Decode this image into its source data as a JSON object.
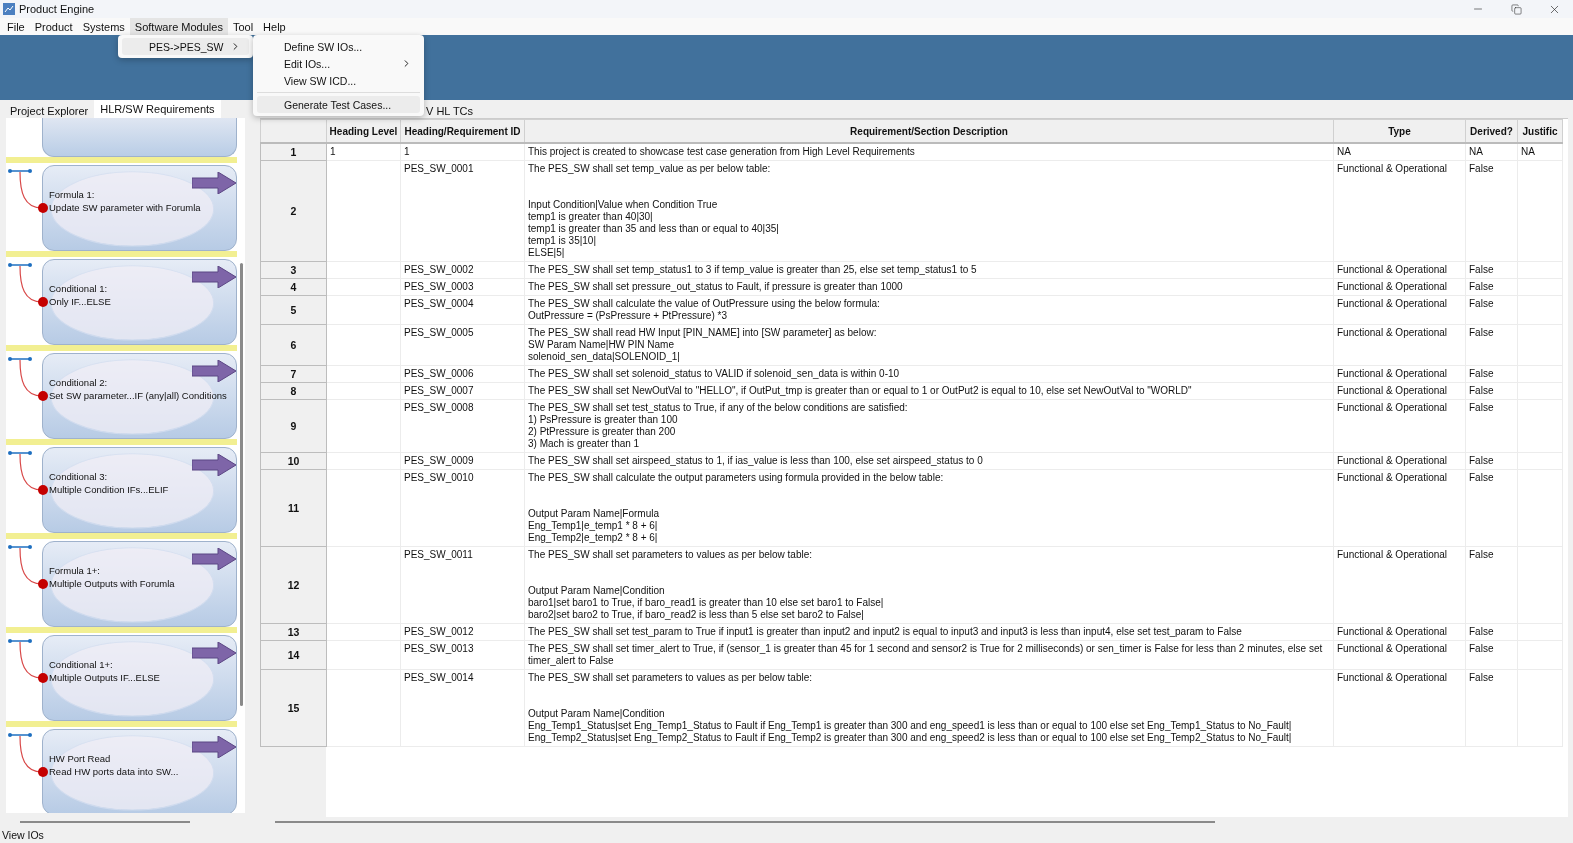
{
  "window": {
    "title": "Product Engine"
  },
  "menu_bar": [
    {
      "label": "File",
      "selected": false
    },
    {
      "label": "Product",
      "selected": false
    },
    {
      "label": "Systems",
      "selected": false
    },
    {
      "label": "Software Modules",
      "selected": true
    },
    {
      "label": "Tool",
      "selected": false
    },
    {
      "label": "Help",
      "selected": false
    }
  ],
  "menu": {
    "items": [
      {
        "label": "PES->PES_SW",
        "selected": true,
        "kind": "submenu"
      }
    ]
  },
  "submenu": {
    "items": [
      {
        "kind": "item",
        "label": "Define SW IOs...",
        "selected": false
      },
      {
        "kind": "submenu",
        "label": "Edit IOs...",
        "selected": false
      },
      {
        "kind": "item",
        "label": "View SW ICD...",
        "selected": false
      },
      {
        "kind": "separator"
      },
      {
        "kind": "item",
        "label": "Generate Test Cases...",
        "selected": true
      }
    ]
  },
  "left_tabs": [
    {
      "label": "Project Explorer",
      "selected": false
    },
    {
      "label": "HLR/SW Requirements",
      "selected": true
    }
  ],
  "right_tabs": [
    {
      "label": "V HL TCs",
      "selected": false
    }
  ],
  "templates": [
    {
      "title": "Formula 1:",
      "subtitle": "Update SW parameter with Forumla"
    },
    {
      "title": "Conditional 1:",
      "subtitle": "Only IF...ELSE"
    },
    {
      "title": "Conditional 2:",
      "subtitle": "Set SW parameter...IF (any|all) Conditions"
    },
    {
      "title": "Conditional 3:",
      "subtitle": "Multiple Condition IFs...ELIF"
    },
    {
      "title": "Formula 1+:",
      "subtitle": "Multiple Outputs with Forumla"
    },
    {
      "title": "Conditional 1+:",
      "subtitle": "Multiple Outputs IF...ELSE"
    },
    {
      "title": "HW Port Read",
      "subtitle": "Read HW ports data into SW..."
    }
  ],
  "table": {
    "columns": [
      "Heading Level",
      "Heading/Requirement ID",
      "Requirement/Section Description",
      "Type",
      "Derived?",
      "Justific"
    ],
    "rows": [
      {
        "number": "1",
        "heading_level": "1",
        "id": "1",
        "description": "This project is created to showcase test case generation from High Level Requirements",
        "type": "NA",
        "derived": "NA",
        "justification": "NA"
      },
      {
        "number": "2",
        "id": "PES_SW_0001",
        "description": "The PES_SW shall set temp_value as per below table:\n\n\nInput Condition|Value when Condition True\ntemp1 is greater than 40|30|\ntemp1 is greater than 35 and less than or equal to 40|35|\ntemp1 is 35|10|\nELSE|5|",
        "type": "Functional & Operational",
        "derived": "False"
      },
      {
        "number": "3",
        "id": "PES_SW_0002",
        "description": "The PES_SW shall set temp_status1 to 3 if temp_value is greater than 25, else set temp_status1 to 5",
        "type": "Functional & Operational",
        "derived": "False"
      },
      {
        "number": "4",
        "id": "PES_SW_0003",
        "description": "The PES_SW shall set pressure_out_status to Fault, if pressure is greater than 1000",
        "type": "Functional & Operational",
        "derived": "False"
      },
      {
        "number": "5",
        "id": "PES_SW_0004",
        "description": "The PES_SW shall calculate the value of OutPressure using the below formula:\nOutPressure = (PsPressure + PtPressure) *3",
        "type": "Functional & Operational",
        "derived": "False"
      },
      {
        "number": "6",
        "id": "PES_SW_0005",
        "description": "The PES_SW shall read HW Input [PIN_NAME] into [SW parameter] as below:\nSW Param Name|HW PIN Name\nsolenoid_sen_data|SOLENOID_1|",
        "type": "Functional & Operational",
        "derived": "False"
      },
      {
        "number": "7",
        "id": "PES_SW_0006",
        "description": "The PES_SW shall set solenoid_status to VALID if solenoid_sen_data is within 0-10",
        "type": "Functional & Operational",
        "derived": "False"
      },
      {
        "number": "8",
        "id": "PES_SW_0007",
        "description": "The PES_SW shall set NewOutVal to \"HELLO\", if OutPut_tmp is greater than or equal to 1 or OutPut2 is equal to 10, else set NewOutVal to \"WORLD\"",
        "type": "Functional & Operational",
        "derived": "False"
      },
      {
        "number": "9",
        "id": "PES_SW_0008",
        "description": "The PES_SW shall set test_status to True, if any of the below conditions are satisfied:\n1) PsPressure is greater than 100\n2) PtPressure is greater than 200\n3) Mach is greater than 1",
        "type": "Functional & Operational",
        "derived": "False"
      },
      {
        "number": "10",
        "id": "PES_SW_0009",
        "description": "The PES_SW shall set airspeed_status to 1, if ias_value is less than 100, else set airspeed_status to 0",
        "type": "Functional & Operational",
        "derived": "False"
      },
      {
        "number": "11",
        "id": "PES_SW_0010",
        "description": "The PES_SW shall calculate the output parameters using formula provided in the below table:\n\n\nOutput Param Name|Formula\nEng_Temp1|e_temp1 * 8 + 6|\nEng_Temp2|e_temp2 * 8 + 6|",
        "type": "Functional & Operational",
        "derived": "False"
      },
      {
        "number": "12",
        "id": "PES_SW_0011",
        "description": "The PES_SW shall set parameters to values as per below table:\n\n\nOutput Param Name|Condition\nbaro1|set baro1 to True, if baro_read1 is greater than 10 else set baro1 to False|\nbaro2|set baro2 to True, if baro_read2 is less than 5 else set baro2 to False|",
        "type": "Functional & Operational",
        "derived": "False"
      },
      {
        "number": "13",
        "id": "PES_SW_0012",
        "description": "The PES_SW shall set test_param to True if input1 is greater than input2 and input2 is equal to input3 and input3 is less than input4, else set test_param to False",
        "type": "Functional & Operational",
        "derived": "False"
      },
      {
        "number": "14",
        "id": "PES_SW_0013",
        "description": "The PES_SW shall set timer_alert to True, if (sensor_1 is greater than 45 for 1 second and sensor2 is True for 2 milliseconds) or sen_timer is False for less than 2 minutes, else set timer_alert to False",
        "type": "Functional & Operational",
        "derived": "False"
      },
      {
        "number": "15",
        "id": "PES_SW_0014",
        "description": "The PES_SW shall set parameters to values as per below table:\n\n\nOutput Param Name|Condition\nEng_Temp1_Status|set Eng_Temp1_Status to Fault if Eng_Temp1 is greater than 300 and eng_speed1 is less than or equal to 100 else set Eng_Temp1_Status to No_Fault|\nEng_Temp2_Status|set Eng_Temp2_Status to Fault if Eng_Temp2 is greater than 300 and eng_speed2 is less than or equal to 100 else set Eng_Temp2_Status to No_Fault|",
        "type": "Functional & Operational",
        "derived": "False"
      }
    ]
  },
  "status_bar": {
    "text": "View IOs"
  }
}
